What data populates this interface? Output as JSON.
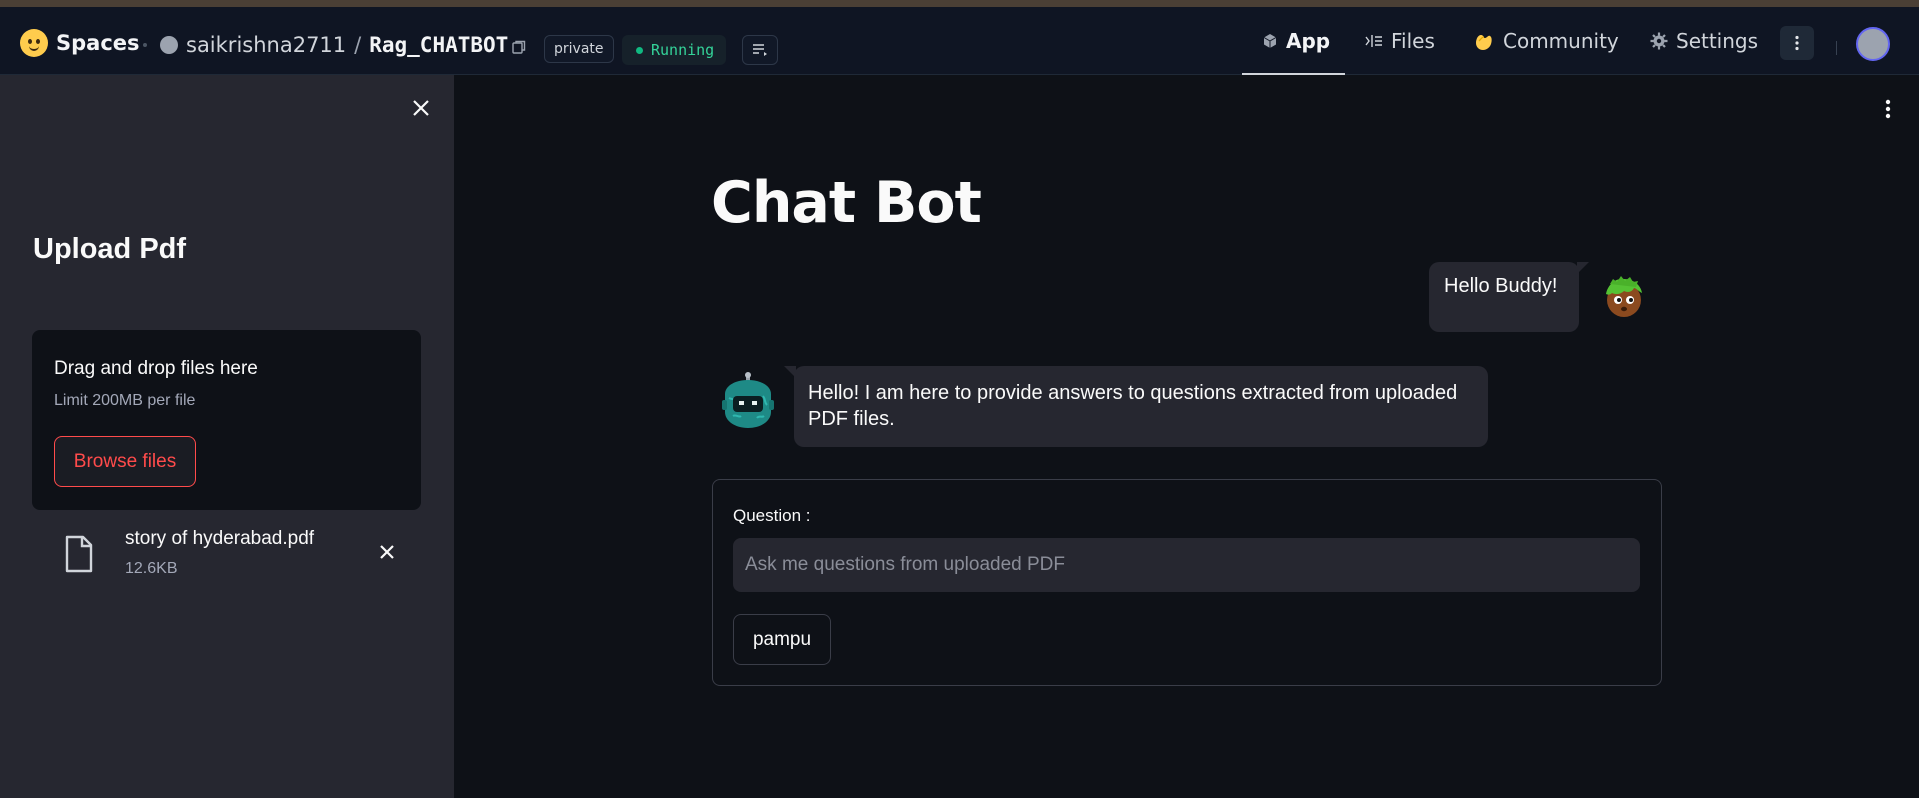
{
  "header": {
    "brand": "Spaces",
    "repo_owner": "saikrishna2711",
    "repo_slash": "/",
    "repo_name": "Rag_CHATBOT",
    "visibility_badge": "private",
    "status_badge": "Running",
    "nav": {
      "app": "App",
      "files": "Files",
      "community": "Community",
      "settings": "Settings"
    },
    "icons": [
      "huggingface-logo-icon",
      "copy-icon",
      "logs-icon",
      "cube-icon",
      "files-icon",
      "community-icon",
      "gear-icon",
      "more-vertical-icon",
      "user-avatar"
    ]
  },
  "sidebar": {
    "title": "Upload Pdf",
    "uploader": {
      "drop_text": "Drag and drop files here",
      "limit_text": "Limit 200MB per file",
      "browse_label": "Browse files"
    },
    "files": [
      {
        "name": "story of hyderabad.pdf",
        "size": "12.6KB"
      }
    ]
  },
  "main": {
    "title": "Chat Bot",
    "messages": [
      {
        "role": "user",
        "text": "Hello Buddy!"
      },
      {
        "role": "assistant",
        "text": "Hello! I am here to provide answers to questions extracted from uploaded PDF files."
      }
    ],
    "form": {
      "label": "Question :",
      "placeholder": "Ask me questions from uploaded PDF",
      "value": "",
      "submit_label": "pampu"
    }
  },
  "colors": {
    "background": "#0e1117",
    "sidebar": "#262730",
    "header": "#0f1523",
    "accent_red": "#ff4b4b",
    "status_green": "#10b981"
  }
}
